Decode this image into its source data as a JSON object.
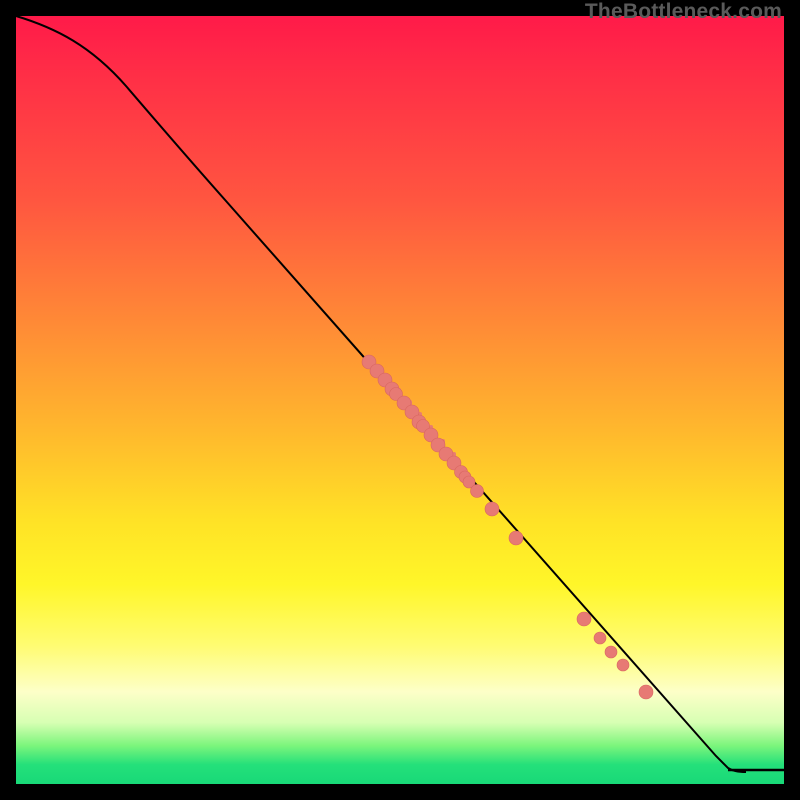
{
  "watermark": "TheBottleneck.com",
  "colors": {
    "dot": "#e77a74",
    "curve": "#000000",
    "gradient_top": "#ff1a49",
    "gradient_mid": "#ffe326",
    "gradient_bottom": "#18d978",
    "page_bg": "#000000"
  },
  "chart_data": {
    "type": "line",
    "title": "",
    "xlabel": "",
    "ylabel": "",
    "xlim": [
      0,
      100
    ],
    "ylim": [
      0,
      100
    ],
    "grid": false,
    "legend": false,
    "series": [
      {
        "name": "bottleneck-curve",
        "x": [
          0,
          5,
          10,
          15,
          20,
          25,
          30,
          35,
          40,
          45,
          50,
          55,
          60,
          65,
          70,
          75,
          80,
          85,
          90,
          92,
          95,
          100
        ],
        "y": [
          100,
          98,
          95,
          90,
          84,
          78,
          72,
          66,
          60,
          54,
          48,
          42,
          36,
          31,
          25,
          20,
          14,
          9,
          3,
          2,
          2,
          2
        ]
      }
    ],
    "points": [
      {
        "x": 46,
        "y": 55
      },
      {
        "x": 47,
        "y": 53.8
      },
      {
        "x": 48,
        "y": 52.6
      },
      {
        "x": 49,
        "y": 51.4
      },
      {
        "x": 49.5,
        "y": 50.8
      },
      {
        "x": 50.5,
        "y": 49.6
      },
      {
        "x": 51.5,
        "y": 48.4
      },
      {
        "x": 52.5,
        "y": 47.2
      },
      {
        "x": 53,
        "y": 46.6
      },
      {
        "x": 54,
        "y": 45.4
      },
      {
        "x": 55,
        "y": 44.2
      },
      {
        "x": 56,
        "y": 43
      },
      {
        "x": 57,
        "y": 41.8
      },
      {
        "x": 58,
        "y": 40.6
      },
      {
        "x": 58.5,
        "y": 40
      },
      {
        "x": 59,
        "y": 39.4
      },
      {
        "x": 60,
        "y": 38.2
      },
      {
        "x": 62,
        "y": 35.8
      },
      {
        "x": 65,
        "y": 32
      },
      {
        "x": 74,
        "y": 21.5
      },
      {
        "x": 76,
        "y": 19
      },
      {
        "x": 77.5,
        "y": 17.2
      },
      {
        "x": 79,
        "y": 15.5
      },
      {
        "x": 82,
        "y": 12
      }
    ],
    "annotations": [
      {
        "text": "TheBottleneck.com",
        "position": "top-right"
      }
    ]
  }
}
